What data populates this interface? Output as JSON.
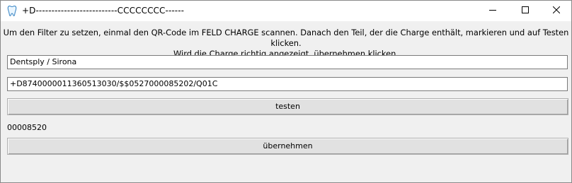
{
  "window": {
    "title": "+D--------------------------CCCCCCCC------",
    "app_icon": "tooth-icon",
    "controls": {
      "minimize_icon": "minimize-icon",
      "maximize_icon": "maximize-icon",
      "close_icon": "close-icon"
    }
  },
  "instructions": {
    "line1": "Um den Filter zu setzen, einmal den QR-Code im FELD CHARGE scannen. Danach den Teil, der die Charge enthält, markieren und auf Testen klicken.",
    "line2": "Wird die Charge richtig angezeigt, übernehmen klicken."
  },
  "form": {
    "manufacturer_value": "Dentsply / Sirona",
    "code_value": "+D8740000011360513030/$$0527000085202/Q01C",
    "test_button_label": "testen",
    "result_value": "00008520",
    "accept_button_label": "übernehmen"
  },
  "colors": {
    "window_bg": "#f0f0f0",
    "titlebar_bg": "#ffffff",
    "button_bg": "#e1e1e1"
  }
}
